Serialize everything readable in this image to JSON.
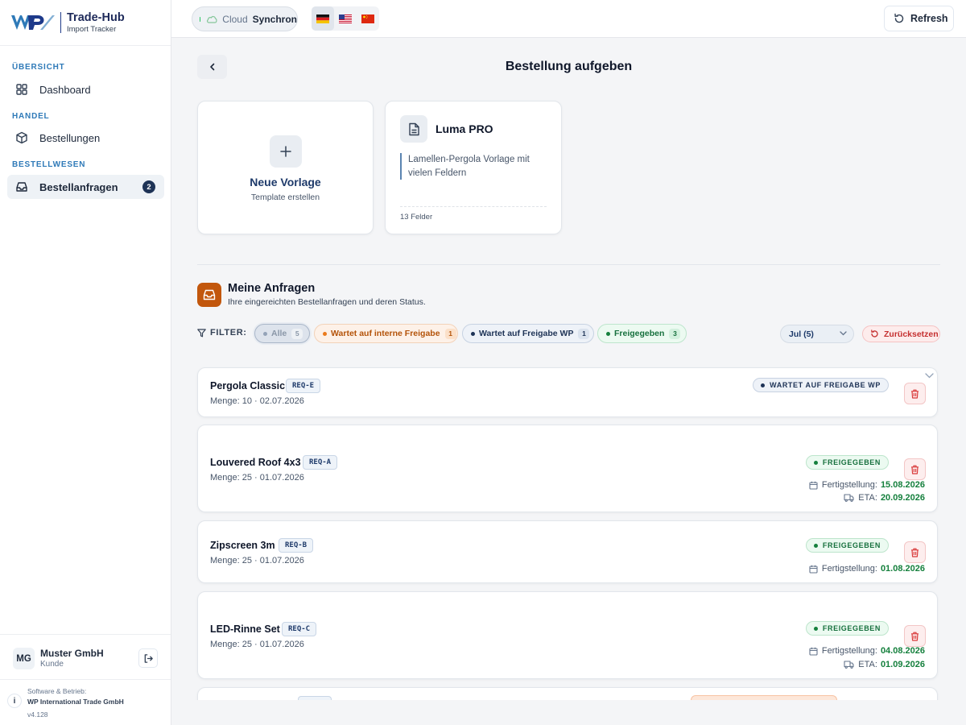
{
  "brand": {
    "name": "Trade-Hub",
    "subtitle": "Import Tracker",
    "logo_text": "WP"
  },
  "sidebar": {
    "sections": [
      {
        "label": "ÜBERSICHT",
        "items": [
          {
            "label": "Dashboard",
            "icon": "grid-icon"
          }
        ]
      },
      {
        "label": "HANDEL",
        "items": [
          {
            "label": "Bestellungen",
            "icon": "box-icon"
          }
        ]
      },
      {
        "label": "BESTELLWESEN",
        "items": [
          {
            "label": "Bestellanfragen",
            "icon": "inbox-icon",
            "badge": "2",
            "active": true
          }
        ]
      }
    ],
    "user": {
      "initials": "MG",
      "name": "Muster GmbH",
      "role": "Kunde"
    },
    "footer": {
      "line1": "Software & Betrieb:",
      "line2": "WP International Trade GmbH",
      "version": "v4.128"
    }
  },
  "topbar": {
    "cloud_label": "Cloud",
    "cloud_status": "Synchron",
    "languages": [
      "de-flag",
      "us-flag",
      "cn-flag"
    ],
    "active_language": "de-flag",
    "refresh_label": "Refresh"
  },
  "page": {
    "title": "Bestellung aufgeben"
  },
  "templates": {
    "new": {
      "title": "Neue Vorlage",
      "subtitle": "Template erstellen"
    },
    "items": [
      {
        "title": "Luma PRO",
        "description": "Lamellen-Pergola Vorlage mit vielen Feldern",
        "fields": "13 Felder"
      }
    ]
  },
  "requests": {
    "title": "Meine Anfragen",
    "subtitle": "Ihre eingereichten Bestellanfragen und deren Status.",
    "filter_label": "FILTER:",
    "filters": [
      {
        "label": "Alle",
        "count": "5"
      },
      {
        "label": "Wartet auf interne Freigabe",
        "count": "1"
      },
      {
        "label": "Wartet auf Freigabe WP",
        "count": "1"
      },
      {
        "label": "Freigegeben",
        "count": "3"
      }
    ],
    "month": "Jul (5)",
    "reset_label": "Zurücksetzen",
    "list": [
      {
        "name": "Pergola Classic",
        "code": "REQ-E",
        "meta": "Menge: 10 · 02.07.2026",
        "status": "WARTET AUF FREIGABE WP"
      },
      {
        "name": "Louvered Roof 4x3",
        "code": "REQ-A",
        "meta": "Menge: 25 · 01.07.2026",
        "status": "FREIGEGEBEN",
        "fertigstellung": "15.08.2026",
        "eta": "20.09.2026"
      },
      {
        "name": "Zipscreen 3m",
        "code": "REQ-B",
        "meta": "Menge: 25 · 01.07.2026",
        "status": "FREIGEGEBEN",
        "fertigstellung": "01.08.2026"
      },
      {
        "name": "LED-Rinne Set",
        "code": "REQ-C",
        "meta": "Menge: 25 · 01.07.2026",
        "status": "FREIGEGEBEN",
        "fertigstellung": "04.08.2026",
        "eta": "01.09.2026"
      }
    ],
    "labels": {
      "fertigstellung": "Fertigstellung:",
      "eta": "ETA:"
    }
  },
  "colors": {
    "navy": "#1e3356",
    "accent_blue": "#2f7ab8",
    "success": "#15803d",
    "danger": "#c53030",
    "orange": "#c2570d"
  }
}
